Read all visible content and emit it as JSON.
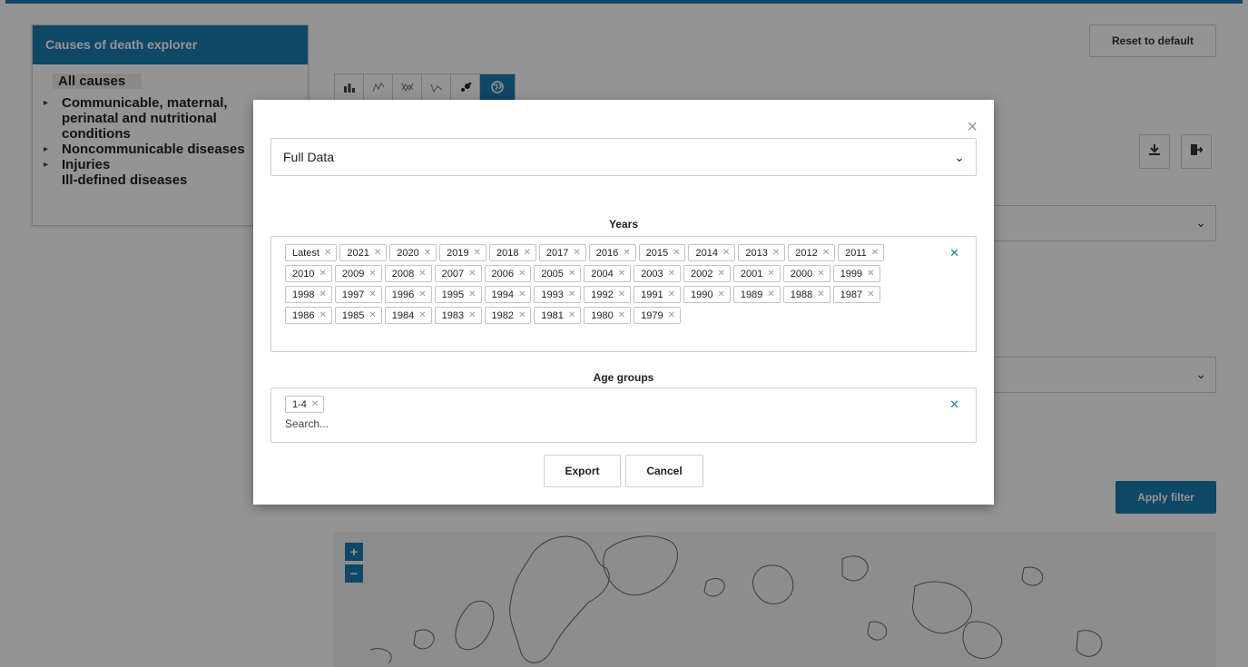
{
  "sidebar": {
    "title": "Causes of death explorer",
    "items": [
      {
        "label": "All causes",
        "expandable": false
      },
      {
        "label": "Communicable, maternal, perinatal and nutritional conditions",
        "expandable": true
      },
      {
        "label": "Noncommunicable diseases",
        "expandable": true
      },
      {
        "label": "Injuries",
        "expandable": true
      },
      {
        "label": "Ill-defined diseases",
        "expandable": false
      }
    ]
  },
  "toolbar": {
    "chart_tabs": [
      "bar-chart-icon",
      "line-chart-icon",
      "ranking-icon",
      "trend-chart-icon",
      "scatter-icon",
      "globe-icon"
    ],
    "active_tab": "globe-icon",
    "reset_label": "Reset to default",
    "apply_label": "Apply filter"
  },
  "map": {
    "zoom_in": "+",
    "zoom_out": "−"
  },
  "modal": {
    "select_value": "Full Data",
    "years_label": "Years",
    "years": [
      "Latest",
      "2021",
      "2020",
      "2019",
      "2018",
      "2017",
      "2016",
      "2015",
      "2014",
      "2013",
      "2012",
      "2011",
      "2010",
      "2009",
      "2008",
      "2007",
      "2006",
      "2005",
      "2004",
      "2003",
      "2002",
      "2001",
      "2000",
      "1999",
      "1998",
      "1997",
      "1996",
      "1995",
      "1994",
      "1993",
      "1992",
      "1991",
      "1990",
      "1989",
      "1988",
      "1987",
      "1986",
      "1985",
      "1984",
      "1983",
      "1982",
      "1981",
      "1980",
      "1979"
    ],
    "age_groups_label": "Age groups",
    "age_groups": [
      "1-4"
    ],
    "search_placeholder": "Search...",
    "export_label": "Export",
    "cancel_label": "Cancel"
  },
  "colors": {
    "accent": "#1b7bb0",
    "border": "#cfcfcf"
  }
}
